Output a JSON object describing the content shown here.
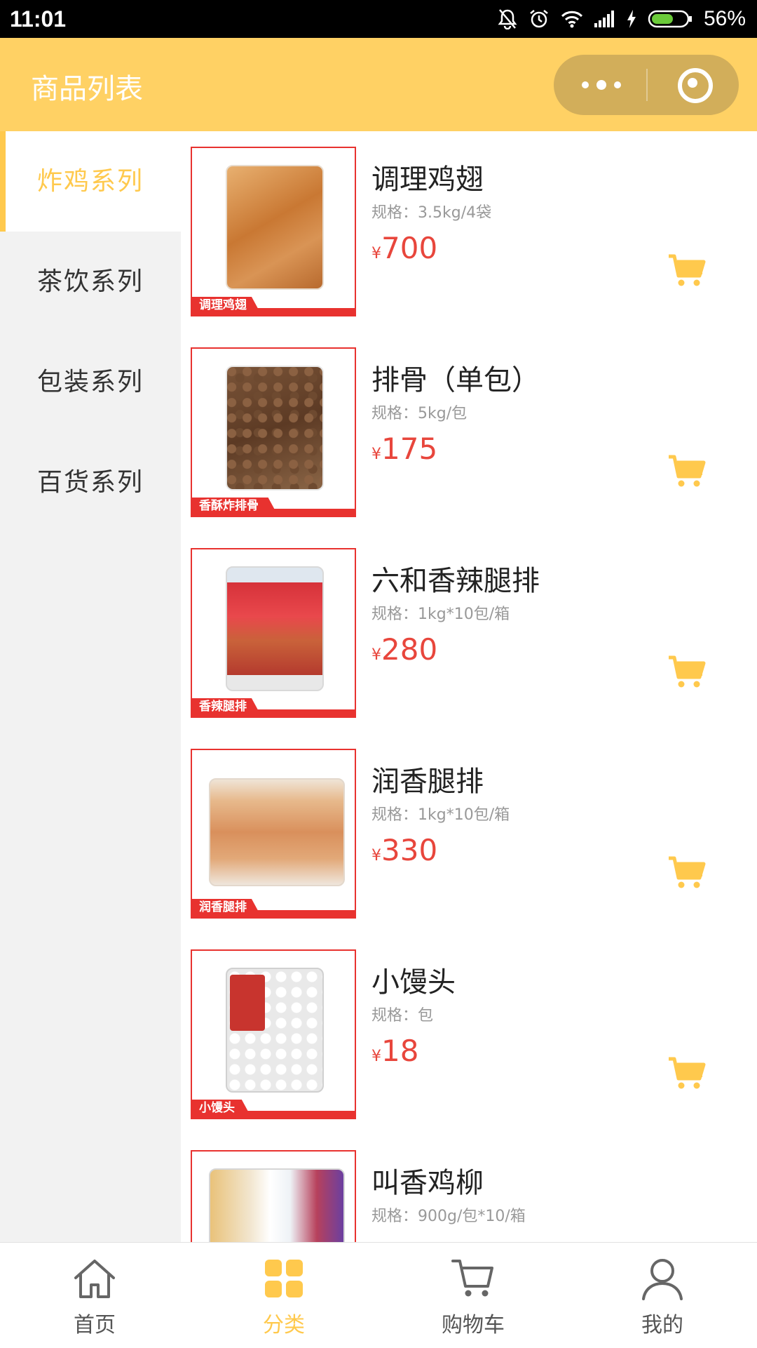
{
  "status_bar": {
    "time": "11:01",
    "battery": "56%"
  },
  "nav": {
    "title": "商品列表"
  },
  "colors": {
    "accent": "#FFD164",
    "active_text": "#FFC94D",
    "price": "#E8463C",
    "ribbon": "#E8322F"
  },
  "sidebar": {
    "items": [
      {
        "label": "炸鸡系列",
        "active": true
      },
      {
        "label": "茶饮系列",
        "active": false
      },
      {
        "label": "包装系列",
        "active": false
      },
      {
        "label": "百货系列",
        "active": false
      }
    ]
  },
  "currency_symbol": "¥",
  "products": [
    {
      "name": "调理鸡翅",
      "spec": "规格：3.5kg/4袋",
      "price": "700",
      "tag": "调理鸡翅",
      "icon": "cart-icon"
    },
    {
      "name": "排骨（单包）",
      "spec": "规格：5kg/包",
      "price": "175",
      "tag": "香酥炸排骨",
      "icon": "cart-icon"
    },
    {
      "name": "六和香辣腿排",
      "spec": "规格：1kg*10包/箱",
      "price": "280",
      "tag": "香辣腿排",
      "icon": "cart-icon"
    },
    {
      "name": "润香腿排",
      "spec": "规格：1kg*10包/箱",
      "price": "330",
      "tag": "润香腿排",
      "icon": "cart-icon"
    },
    {
      "name": "小馒头",
      "spec": "规格：包",
      "price": "18",
      "tag": "小馒头",
      "icon": "cart-icon"
    },
    {
      "name": "叫香鸡柳",
      "spec": "规格：900g/包*10/箱",
      "price": "",
      "tag": "",
      "icon": "cart-icon"
    }
  ],
  "tabbar": {
    "items": [
      {
        "label": "首页",
        "icon": "home-icon",
        "active": false
      },
      {
        "label": "分类",
        "icon": "category-icon",
        "active": true
      },
      {
        "label": "购物车",
        "icon": "cart-icon",
        "active": false
      },
      {
        "label": "我的",
        "icon": "user-icon",
        "active": false
      }
    ]
  }
}
